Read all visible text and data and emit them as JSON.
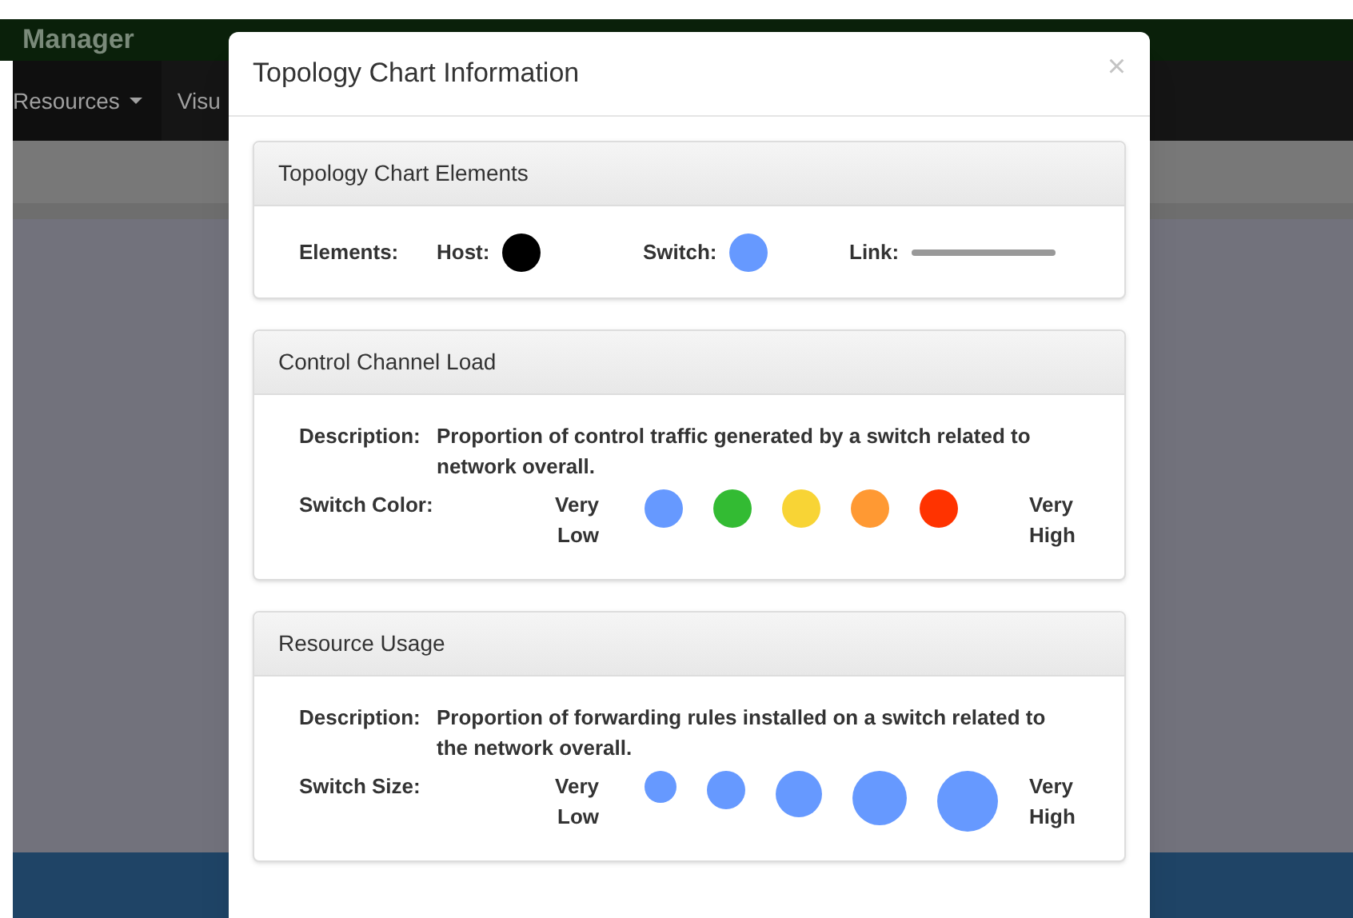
{
  "background": {
    "brand": "Manager",
    "nav_items": [
      {
        "label": "Resources",
        "dropdown": true
      },
      {
        "label": "Visu",
        "dropdown": false
      }
    ]
  },
  "modal": {
    "title": "Topology Chart Information",
    "close": "×",
    "elements_panel": {
      "heading": "Topology Chart Elements",
      "label": "Elements:",
      "items": [
        {
          "kind": "dot",
          "label": "Host:",
          "color": "#000000"
        },
        {
          "kind": "dot",
          "label": "Switch:",
          "color": "#6699ff"
        },
        {
          "kind": "line",
          "label": "Link:",
          "color": "#999999"
        }
      ]
    },
    "load_panel": {
      "heading": "Control Channel Load",
      "description_label": "Description:",
      "description": "Proportion of control traffic generated by a switch related to network overall.",
      "scale_label": "Switch Color:",
      "low": "Very Low",
      "high": "Very High",
      "steps": [
        {
          "color": "#6699ff"
        },
        {
          "color": "#33bb33"
        },
        {
          "color": "#f8d435"
        },
        {
          "color": "#ff9933"
        },
        {
          "color": "#ff3300"
        }
      ]
    },
    "usage_panel": {
      "heading": "Resource Usage",
      "description_label": "Description:",
      "description": "Proportion of forwarding rules installed on a switch related to the network overall.",
      "scale_label": "Switch Size:",
      "low": "Very Low",
      "high": "Very High",
      "steps": [
        {
          "color": "#6699ff"
        },
        {
          "color": "#6699ff"
        },
        {
          "color": "#6699ff"
        },
        {
          "color": "#6699ff"
        },
        {
          "color": "#6699ff"
        }
      ]
    }
  }
}
